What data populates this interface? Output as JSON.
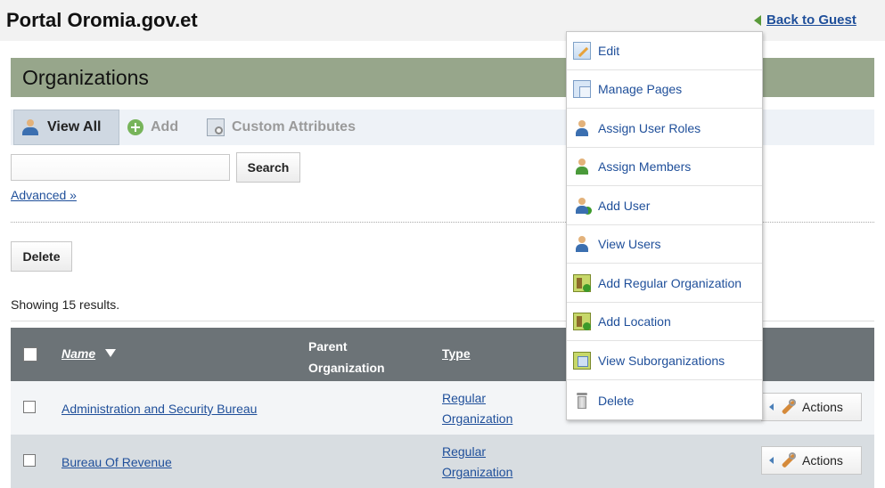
{
  "site": {
    "title": "Portal Oromia.gov.et",
    "back_link": "Back to Guest"
  },
  "portlet": {
    "title": "Organizations"
  },
  "toolbar": {
    "view_all": "View All",
    "add": "Add",
    "custom_attributes": "Custom Attributes"
  },
  "search": {
    "value": "",
    "placeholder": "",
    "button": "Search",
    "advanced": "Advanced »"
  },
  "actions_bar": {
    "delete": "Delete"
  },
  "results": {
    "showing": "Showing 15 results."
  },
  "table": {
    "headers": {
      "name": "Name",
      "parent_organization": "Parent Organization",
      "type": "Type"
    },
    "rows": [
      {
        "name": "Administration and Security Bureau",
        "parent": "",
        "type": "Regular Organization",
        "actions": "Actions"
      },
      {
        "name": "Bureau Of Revenue",
        "parent": "",
        "type": "Regular Organization",
        "actions": "Actions"
      }
    ]
  },
  "menu": {
    "items": [
      {
        "label": "Edit",
        "icon": "edit-icon"
      },
      {
        "label": "Manage Pages",
        "icon": "pages-icon"
      },
      {
        "label": "Assign User Roles",
        "icon": "user-roles-icon"
      },
      {
        "label": "Assign Members",
        "icon": "assign-members-icon"
      },
      {
        "label": "Add User",
        "icon": "add-user-icon"
      },
      {
        "label": "View Users",
        "icon": "view-users-icon"
      },
      {
        "label": "Add Regular Organization",
        "icon": "add-organization-icon"
      },
      {
        "label": "Add Location",
        "icon": "add-location-icon"
      },
      {
        "label": "View Suborganizations",
        "icon": "suborganizations-icon"
      },
      {
        "label": "Delete",
        "icon": "trash-icon"
      }
    ]
  }
}
